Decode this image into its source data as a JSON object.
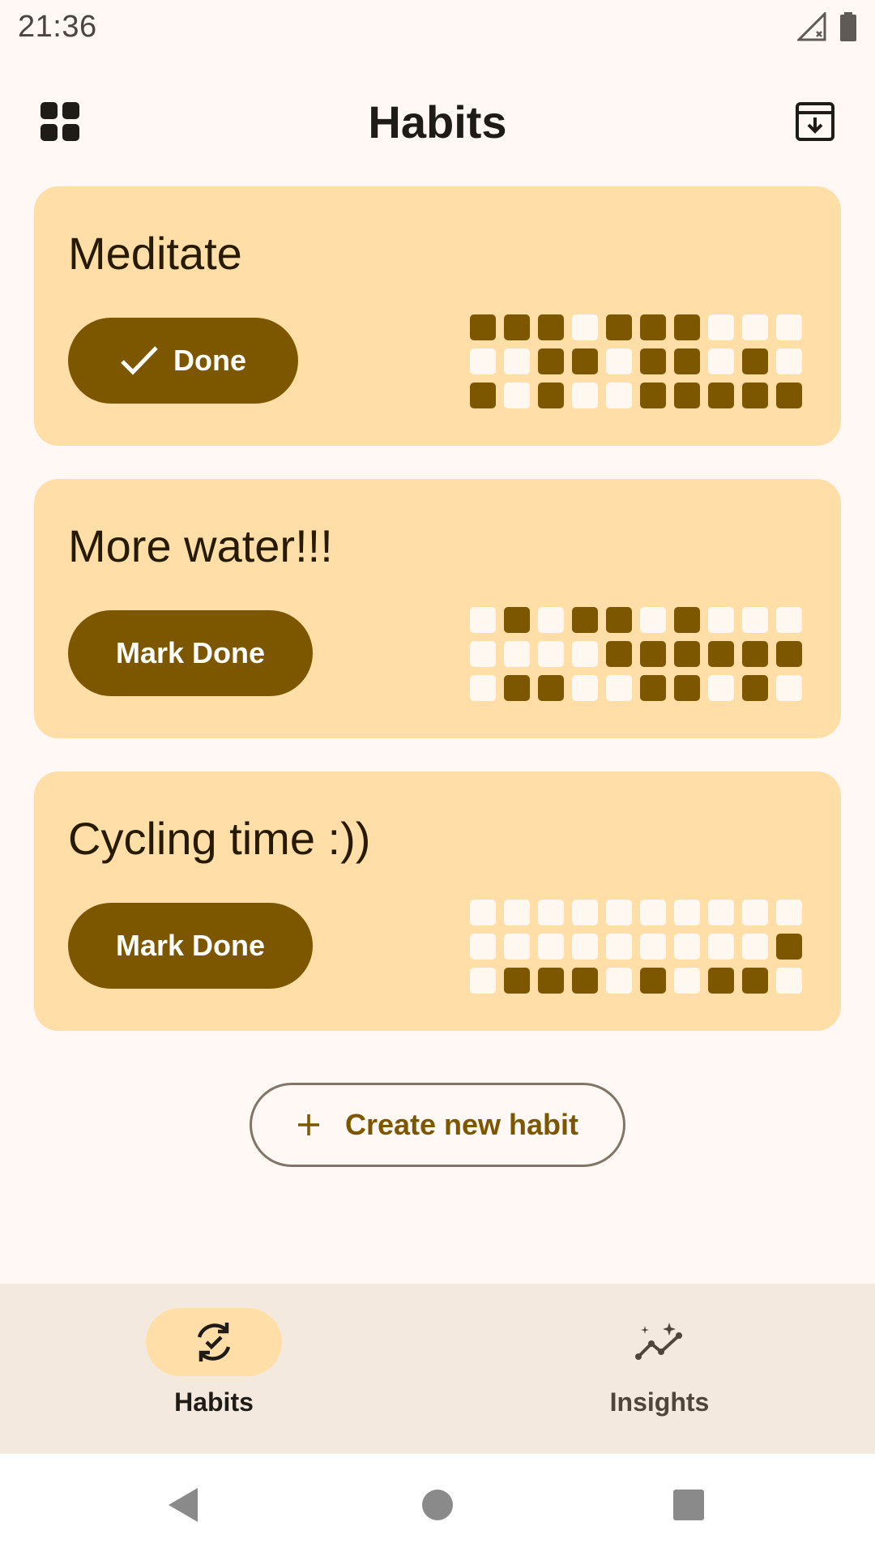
{
  "status": {
    "time": "21:36"
  },
  "header": {
    "title": "Habits"
  },
  "habits": [
    {
      "title": "Meditate",
      "button": "Done",
      "done": true,
      "grid": [
        [
          1,
          1,
          1,
          0,
          1,
          1,
          1,
          0,
          0,
          0
        ],
        [
          0,
          0,
          1,
          1,
          0,
          1,
          1,
          0,
          1,
          0
        ],
        [
          1,
          0,
          1,
          0,
          0,
          1,
          1,
          1,
          1,
          1
        ]
      ]
    },
    {
      "title": "More water!!!",
      "button": "Mark Done",
      "done": false,
      "grid": [
        [
          0,
          1,
          0,
          1,
          1,
          0,
          1,
          0,
          0,
          0
        ],
        [
          0,
          0,
          0,
          0,
          1,
          1,
          1,
          1,
          1,
          1
        ],
        [
          0,
          1,
          1,
          0,
          0,
          1,
          1,
          0,
          1,
          0
        ]
      ]
    },
    {
      "title": "Cycling time :))",
      "button": "Mark Done",
      "done": false,
      "grid": [
        [
          0,
          0,
          0,
          0,
          0,
          0,
          0,
          0,
          0,
          0
        ],
        [
          0,
          0,
          0,
          0,
          0,
          0,
          0,
          0,
          0,
          1
        ],
        [
          0,
          1,
          1,
          1,
          0,
          1,
          0,
          1,
          1,
          0
        ]
      ]
    }
  ],
  "create_button": {
    "label": "Create new habit"
  },
  "nav": {
    "habits_label": "Habits",
    "insights_label": "Insights"
  },
  "colors": {
    "accent": "#7D5700",
    "card": "#FFDEA8",
    "background": "#FFF8F4",
    "cell_empty": "#FFF8F0"
  },
  "icons": {
    "menu": "grid-view-icon",
    "archive": "archive-download-icon",
    "check": "check-icon",
    "add": "plus-icon",
    "habits_nav": "sync-check-icon",
    "insights_nav": "insights-sparkle-icon"
  }
}
